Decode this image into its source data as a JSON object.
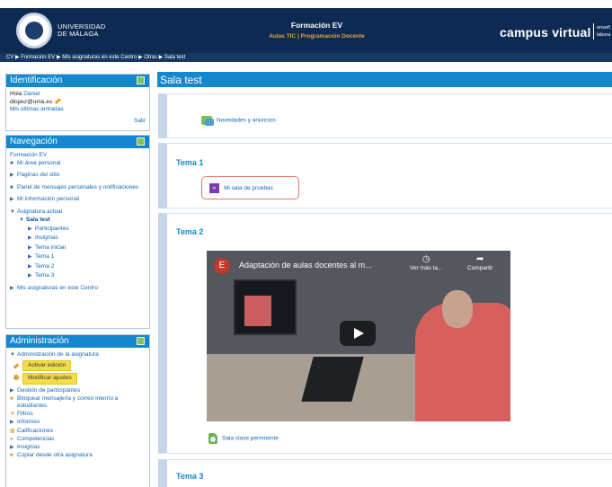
{
  "header": {
    "university_line1": "UNIVERSIDAD",
    "university_line2": "DE MÁLAGA",
    "course_title": "Formación EV",
    "course_subtitle": "Aulas TIC | Programación Docente",
    "brand": "campus virtual",
    "brand_tag1": "enseñ",
    "brand_tag2": "labora"
  },
  "breadcrumb": "CV ▶ Formación EV ▶ Mis asignaturas en este Centro ▶ Otras ▶ Sala test",
  "identificacion": {
    "title": "Identificación",
    "greeting": "Hola",
    "user_name": "Daniel",
    "email": "dlopez@uma.es",
    "last_entries": "Mis últimas entradas",
    "logout": "Salir"
  },
  "navegacion": {
    "title": "Navegación",
    "root": "Formación EV",
    "mi_area": "Mi área personal",
    "paginas": "Páginas del sitio",
    "panel": "Panel de mensajes personales y notificaciones",
    "mi_info": "Mi información personal",
    "asignatura_actual": "Asignatura actual",
    "course": "Sala test",
    "children": [
      "Participantes",
      "Insignias",
      "Tema inicial",
      "Tema 1",
      "Tema 2",
      "Tema 3"
    ],
    "mis_asignaturas": "Mis asignaturas en este Centro"
  },
  "administracion": {
    "title": "Administración",
    "admin_asignatura": "Administración de la asignatura",
    "activar_edicion": "Activar edición",
    "modificar_ajustes": "Modificar ajustes",
    "gestion": "Gestión de participantes",
    "bloquear": "Bloquear mensajería y correo interno a estudiantes",
    "filtros": "Filtros",
    "informes": "Informes",
    "calificaciones": "Calificaciones",
    "competencias": "Competencias",
    "insignias": "Insignias",
    "copiar": "Copiar desde otra asignatura"
  },
  "main": {
    "title": "Sala test",
    "novedades": "Novedades y anuncios",
    "tema1": "Tema 1",
    "sala_pruebas": "Mi sala de pruebas",
    "tema2": "Tema 2",
    "video": {
      "badge": "E",
      "title": "Adaptación de aulas docentes al m...",
      "watch_later": "Ver más ta...",
      "share": "Compartir"
    },
    "sala_clase": "Sala clase permnente",
    "tema3": "Tema 3"
  },
  "colors": {
    "header_bg": "#0d2a52",
    "block_header": "#1488cf",
    "link": "#1367b8",
    "edit_button": "#f5dd4a"
  }
}
